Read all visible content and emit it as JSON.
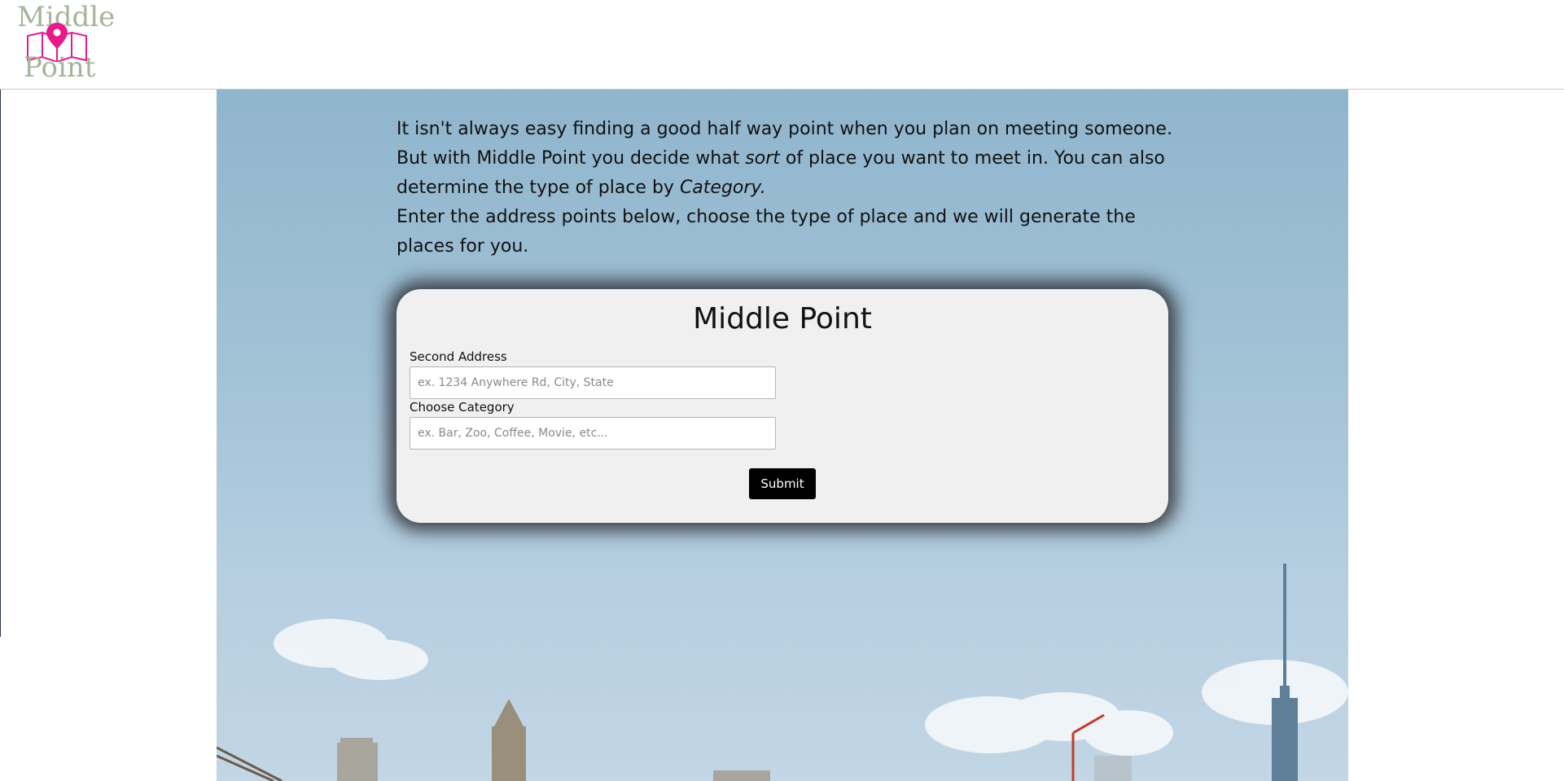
{
  "logo": {
    "line1": "Middle",
    "line2": "Point",
    "icon": "map-pin-icon",
    "accent_color": "#e8198b",
    "text_color": "#a5b49a"
  },
  "intro": {
    "p1_a": "It isn't always easy finding a good half way point when you plan on meeting someone. But with Middle Point you decide what ",
    "p1_em1": "sort",
    "p1_b": " of place you want to meet in. You can also determine the type of place by ",
    "p1_em2": "Category.",
    "p2": "Enter the address points below, choose the type of place and we will generate the places for you."
  },
  "form": {
    "title": "Middle Point",
    "second_address_label": "Second Address",
    "second_address_placeholder": "ex. 1234 Anywhere Rd, City, State",
    "second_address_value": "",
    "category_label": "Choose Category",
    "category_placeholder": "ex. Bar, Zoo, Coffee, Movie, etc...",
    "category_value": "",
    "submit_label": "Submit"
  }
}
